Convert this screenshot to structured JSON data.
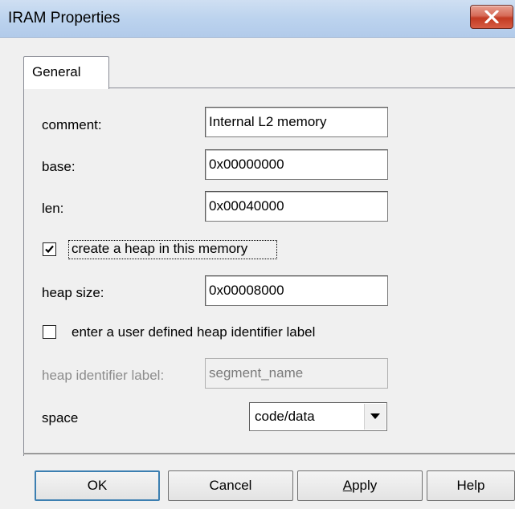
{
  "window": {
    "title": "IRAM Properties"
  },
  "tabs": [
    {
      "label": "General"
    }
  ],
  "form": {
    "comment": {
      "label": "comment:",
      "value": "Internal L2 memory"
    },
    "base": {
      "label": "base:",
      "value": "0x00000000"
    },
    "len": {
      "label": "len:",
      "value": "0x00040000"
    },
    "create_heap": {
      "label": "create a heap in this memory",
      "checked": true
    },
    "heap_size": {
      "label": "heap size:",
      "value": "0x00008000"
    },
    "user_heap_label": {
      "label": "enter a user defined heap identifier label",
      "checked": false
    },
    "heap_identifier": {
      "label": "heap identifier label:",
      "value": "segment_name",
      "disabled": true
    },
    "space": {
      "label": "space",
      "selected": "code/data"
    }
  },
  "buttons": {
    "ok": "OK",
    "cancel": "Cancel",
    "apply_prefix": "A",
    "apply_rest": "pply",
    "help": "Help"
  },
  "icons": {
    "close": "close-x-icon",
    "checkmark": "checkmark-icon",
    "dropdown": "chevron-down-icon"
  },
  "colors": {
    "title_bar": "#bcd3ee",
    "close_button": "#c23a22",
    "default_button_border": "#3c7fb1"
  }
}
